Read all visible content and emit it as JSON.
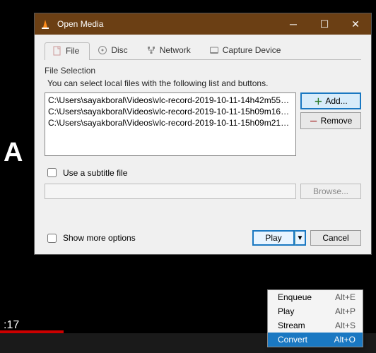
{
  "background": {
    "truncated_text": "A",
    "time": ":17"
  },
  "window": {
    "title": "Open Media",
    "tabs": [
      {
        "label": "File",
        "active": true
      },
      {
        "label": "Disc",
        "active": false
      },
      {
        "label": "Network",
        "active": false
      },
      {
        "label": "Capture Device",
        "active": false
      }
    ],
    "file_section": {
      "heading": "File Selection",
      "description": "You can select local files with the following list and buttons.",
      "files": [
        "C:\\Users\\sayakboral\\Videos\\vlc-record-2019-10-11-14h42m55s-Nat...",
        "C:\\Users\\sayakboral\\Videos\\vlc-record-2019-10-11-15h09m16s-Nat...",
        "C:\\Users\\sayakboral\\Videos\\vlc-record-2019-10-11-15h09m21s-Nat..."
      ],
      "add_label": "Add...",
      "remove_label": "Remove"
    },
    "subtitle": {
      "label": "Use a subtitle file",
      "browse_label": "Browse..."
    },
    "more_options": {
      "label": "Show more options"
    },
    "footer": {
      "play_label": "Play",
      "cancel_label": "Cancel"
    }
  },
  "dropdown": {
    "items": [
      {
        "label": "Enqueue",
        "shortcut": "Alt+E"
      },
      {
        "label": "Play",
        "shortcut": "Alt+P"
      },
      {
        "label": "Stream",
        "shortcut": "Alt+S"
      },
      {
        "label": "Convert",
        "shortcut": "Alt+O",
        "selected": true
      }
    ]
  }
}
